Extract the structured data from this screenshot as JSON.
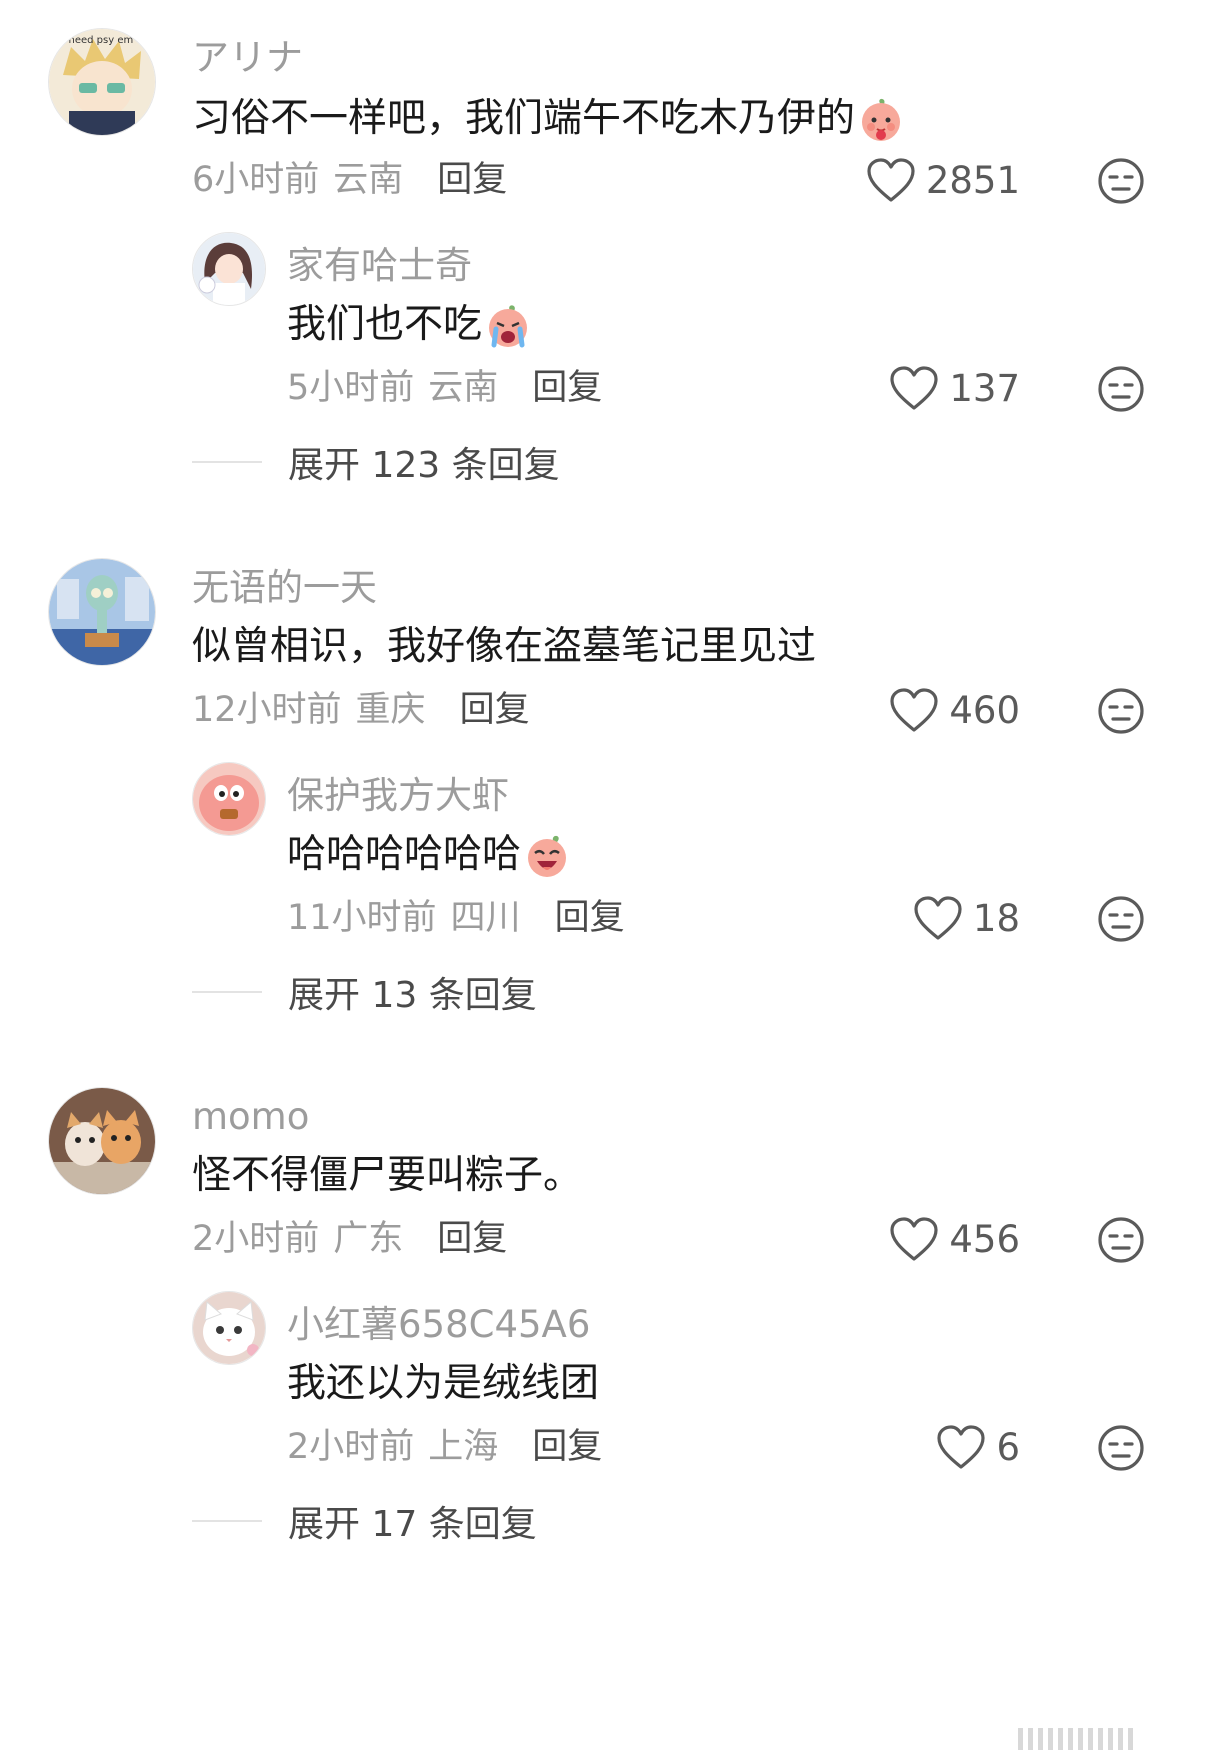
{
  "comments": [
    {
      "username": "アリナ",
      "avatar_icon": "anime-boy-avatar",
      "avatar_text": "u need psy em",
      "text": "习俗不一样吧，我们端午不吃木乃伊的",
      "emoji": "peach-shy-emoji",
      "time": "6小时前",
      "location": "云南",
      "reply_label": "回复",
      "likes": "2851",
      "reply": {
        "username": "家有哈士奇",
        "avatar_icon": "anime-girl-avatar",
        "text": "我们也不吃",
        "emoji": "peach-crying-emoji",
        "time": "5小时前",
        "location": "云南",
        "reply_label": "回复",
        "likes": "137"
      },
      "expand_label": "展开 123 条回复"
    },
    {
      "username": "无语的一天",
      "avatar_icon": "squidward-avatar",
      "text": "似曾相识，我好像在盗墓笔记里见过",
      "time": "12小时前",
      "location": "重庆",
      "reply_label": "回复",
      "likes": "460",
      "reply": {
        "username": "保护我方大虾",
        "avatar_icon": "patrick-avatar",
        "text": "哈哈哈哈哈哈",
        "emoji": "peach-laughing-emoji",
        "time": "11小时前",
        "location": "四川",
        "reply_label": "回复",
        "likes": "18"
      },
      "expand_label": "展开 13 条回复"
    },
    {
      "username": "momo",
      "avatar_icon": "kittens-avatar",
      "text": "怪不得僵尸要叫粽子。",
      "time": "2小时前",
      "location": "广东",
      "reply_label": "回复",
      "likes": "456",
      "reply": {
        "username": "小红薯658C45A6",
        "avatar_icon": "white-cat-avatar",
        "text": "我还以为是绒线团",
        "time": "2小时前",
        "location": "上海",
        "reply_label": "回复",
        "likes": "6"
      },
      "expand_label": "展开 17 条回复"
    }
  ],
  "colors": {
    "text_primary": "#1a1a1a",
    "text_secondary": "#9c9c9c",
    "reply_label": "#4a4a4a",
    "icon_stroke": "#5a5a5a",
    "divider": "#e3e3e3"
  }
}
